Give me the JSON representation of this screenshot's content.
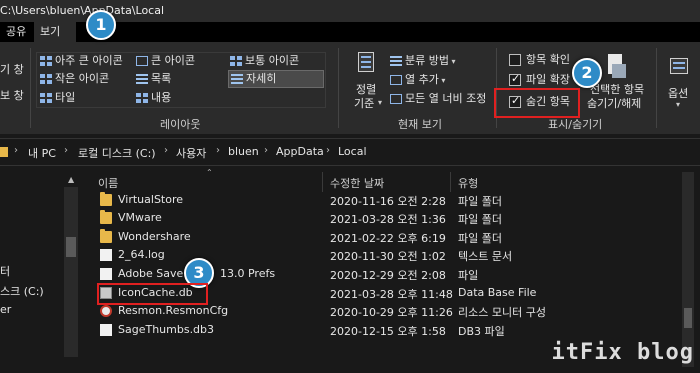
{
  "titlebar": {
    "path": "C:\\Users\\bluen\\AppData\\Local"
  },
  "tabs": [
    {
      "label": "공유"
    },
    {
      "label": "보기"
    }
  ],
  "ribbon": {
    "pane_side": {
      "item1": "기 창",
      "item2": "보 창"
    },
    "layout": {
      "items": [
        {
          "label": "아주 큰 아이콘",
          "icon": "extra-large-icons-icon"
        },
        {
          "label": "큰 아이콘",
          "icon": "large-icons-icon"
        },
        {
          "label": "보통 아이콘",
          "icon": "medium-icons-icon"
        },
        {
          "label": "작은 아이콘",
          "icon": "small-icons-icon"
        },
        {
          "label": "목록",
          "icon": "list-icon"
        },
        {
          "label": "자세히",
          "icon": "details-icon"
        },
        {
          "label": "타일",
          "icon": "tiles-icon"
        },
        {
          "label": "내용",
          "icon": "content-icon"
        }
      ],
      "group_label": "레이아웃"
    },
    "current_view": {
      "sort_label_1": "정렬",
      "sort_label_2": "기준",
      "group_by": "분류 방법",
      "add_column": "열 추가",
      "size_all_columns": "모든 열 너비 조정",
      "group_label": "현재 보기"
    },
    "show_hide": {
      "item_checkboxes": "항목 확인",
      "file_extensions": "파일 확장",
      "hidden_items": "숨긴 항목",
      "hide_selected_1": "선택한 항목",
      "hide_selected_2": "숨기기/해제",
      "group_label": "표시/숨기기"
    },
    "options": "옵션"
  },
  "address": {
    "crumbs": [
      "내 PC",
      "로컬 디스크 (C:)",
      "사용자",
      "bluen",
      "AppData",
      "Local"
    ]
  },
  "navpane": {
    "item1": "터",
    "item2": "스크 (C:)",
    "item3": "er"
  },
  "filelist": {
    "headers": {
      "name": "이름",
      "modified": "수정한 날짜",
      "type": "유형"
    },
    "rows": [
      {
        "name": "VirtualStore",
        "modified": "2020-11-16 오전 2:28",
        "type": "파일 폴더",
        "icon": "folder-icon"
      },
      {
        "name": "VMware",
        "modified": "2021-03-28 오전 1:36",
        "type": "파일 폴더",
        "icon": "folder-icon"
      },
      {
        "name": "Wondershare",
        "modified": "2021-02-22 오후 6:19",
        "type": "파일 폴더",
        "icon": "folder-icon"
      },
      {
        "name": "2_64.log",
        "modified": "2020-11-30 오전 1:02",
        "type": "텍스트 문서",
        "icon": "document-icon"
      },
      {
        "name": "Adobe Save ",
        "modified": "2020-12-29 오전 2:08",
        "type": "파일",
        "icon": "document-icon",
        "suffix": "13.0 Prefs"
      },
      {
        "name": "IconCache.db",
        "modified": "2021-03-28 오후 11:48",
        "type": "Data Base File",
        "icon": "database-icon"
      },
      {
        "name": "Resmon.ResmonCfg",
        "modified": "2020-10-29 오후 11:26",
        "type": "리소스 모니터 구성",
        "icon": "resource-monitor-icon"
      },
      {
        "name": "SageThumbs.db3",
        "modified": "2020-12-15 오후 1:58",
        "type": "DB3 파일",
        "icon": "document-icon"
      }
    ]
  },
  "callouts": [
    "1",
    "2",
    "3"
  ],
  "watermark": "itFix blog",
  "colors": {
    "callout": "#2e8bc7",
    "highlight_box": "#e02020",
    "folder": "#e8b84a"
  }
}
